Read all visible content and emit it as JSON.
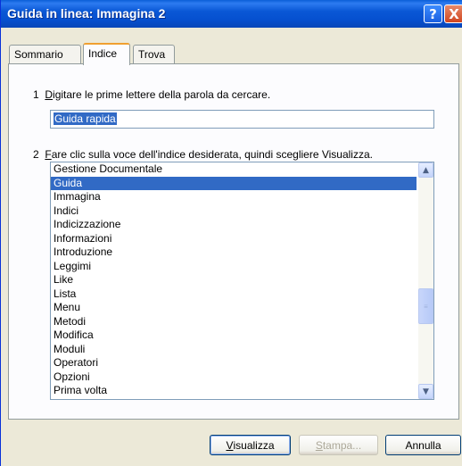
{
  "window": {
    "title": "Guida in linea: Immagina 2",
    "help_glyph": "?",
    "close_glyph": "X"
  },
  "tabs": [
    {
      "label": "Sommario",
      "active": false
    },
    {
      "label": "Indice",
      "active": true
    },
    {
      "label": "Trova",
      "active": false
    }
  ],
  "step1": {
    "number": "1",
    "accel": "D",
    "text": "igitare le prime lettere della parola da cercare."
  },
  "search": {
    "value": "Guida rapida"
  },
  "step2": {
    "number": "2",
    "accel": "F",
    "text": "are clic sulla voce dell'indice desiderata, quindi scegliere Visualizza."
  },
  "index_list": {
    "items": [
      "Gestione Documentale",
      "Guida",
      "Immagina",
      "Indici",
      "Indicizzazione",
      "Informazioni",
      "Introduzione",
      "Leggimi",
      "Like",
      "Lista",
      "Menu",
      "Metodi",
      "Modifica",
      "Moduli",
      "Operatori",
      "Opzioni",
      "Prima volta"
    ],
    "selected_index": 1
  },
  "scrollbar": {
    "up_icon": "▲",
    "down_icon": "▼",
    "thumb_grip": "≡"
  },
  "buttons": {
    "visualizza": {
      "accel": "V",
      "rest": "isualizza",
      "enabled": true
    },
    "stampa": {
      "accel": "S",
      "rest": "tampa...",
      "enabled": false
    },
    "annulla": {
      "label": "Annulla",
      "enabled": true
    }
  },
  "colors": {
    "title_bar": "#0a58d6",
    "selection": "#316ac5",
    "dialog_bg": "#ece9d8",
    "active_tab_accent": "#f0a030"
  }
}
